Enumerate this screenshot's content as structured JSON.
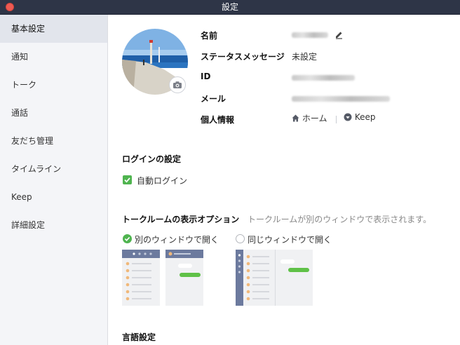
{
  "window": {
    "title": "設定"
  },
  "sidebar": {
    "items": [
      {
        "label": "基本設定",
        "active": true
      },
      {
        "label": "通知",
        "active": false
      },
      {
        "label": "トーク",
        "active": false
      },
      {
        "label": "通話",
        "active": false
      },
      {
        "label": "友だち管理",
        "active": false
      },
      {
        "label": "タイムライン",
        "active": false
      },
      {
        "label": "Keep",
        "active": false
      },
      {
        "label": "詳細設定",
        "active": false
      }
    ]
  },
  "profile": {
    "name_label": "名前",
    "status_label": "ステータスメッセージ",
    "status_value": "未設定",
    "id_label": "ID",
    "mail_label": "メール",
    "personal_label": "個人情報",
    "home_link": "ホーム",
    "keep_link": "Keep"
  },
  "login": {
    "section_title": "ログインの設定",
    "auto_login_label": "自動ログイン",
    "auto_login_checked": true
  },
  "talkroom": {
    "section_title": "トークルームの表示オプション",
    "section_desc": "トークルームが別のウィンドウで表示されます。",
    "option_separate": "別のウィンドウで開く",
    "option_same": "同じウィンドウで開く",
    "selected": "separate"
  },
  "language": {
    "section_title": "言語設定"
  },
  "colors": {
    "accent_green": "#4fb44f",
    "titlebar": "#2e3547",
    "preview_header": "#6c7a9e"
  }
}
